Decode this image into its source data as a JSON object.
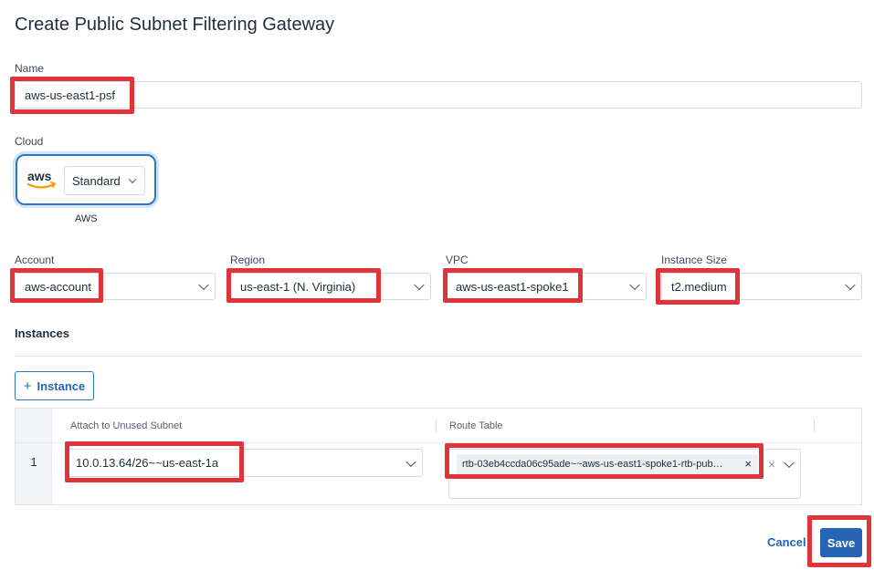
{
  "dialog": {
    "title": "Create Public Subnet Filtering Gateway"
  },
  "name_field": {
    "label": "Name",
    "value": "aws-us-east1-psf"
  },
  "cloud": {
    "label": "Cloud",
    "provider_logo": "aws",
    "option": "Standard",
    "caption": "AWS",
    "logo_icon": "aws-logo-icon"
  },
  "account": {
    "label": "Account",
    "value": "aws-account"
  },
  "region": {
    "label": "Region",
    "value": "us-east-1 (N. Virginia)"
  },
  "vpc": {
    "label": "VPC",
    "value": "aws-us-east1-spoke1"
  },
  "instance_size": {
    "label": "Instance Size",
    "value": "t2.medium"
  },
  "instances": {
    "title": "Instances",
    "add_button": {
      "icon": "+",
      "label": "Instance"
    },
    "columns": [
      "Attach to Unused Subnet",
      "Route Table"
    ],
    "rows": [
      {
        "index": "1",
        "subnet": "10.0.13.64/26~~us-east-1a",
        "route_table_chip": "rtb-03eb4ccda06c95ade~~aws-us-east1-spoke1-rtb-pub…",
        "chip_remove": "×",
        "clear": "×"
      }
    ]
  },
  "footer": {
    "cancel": "Cancel",
    "save": "Save"
  },
  "colors": {
    "accent": "#2565b3",
    "highlight": "#e0333a"
  }
}
